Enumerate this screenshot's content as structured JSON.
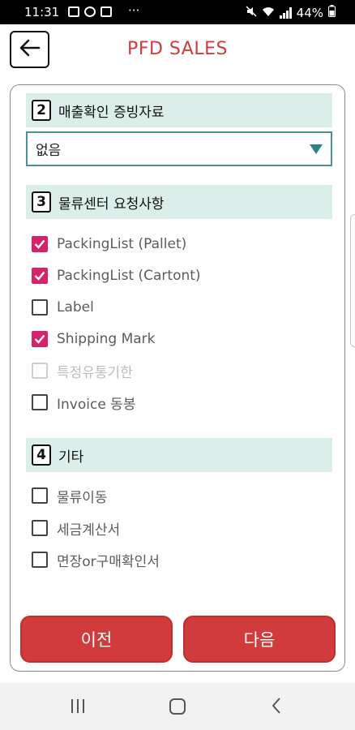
{
  "status_bar": {
    "time": "11:31",
    "dots": "···",
    "battery": "44%"
  },
  "app_bar": {
    "title": "PFD SALES"
  },
  "section2": {
    "number": "2",
    "label": "매출확인 증빙자료",
    "select_value": "없음"
  },
  "section3": {
    "number": "3",
    "label": "물류센터 요청사항",
    "items": [
      {
        "label": "PackingList (Pallet)",
        "checked": true,
        "enabled": true
      },
      {
        "label": "PackingList (Cartont)",
        "checked": true,
        "enabled": true
      },
      {
        "label": "Label",
        "checked": false,
        "enabled": true
      },
      {
        "label": "Shipping Mark",
        "checked": true,
        "enabled": true
      },
      {
        "label": "특정유통기한",
        "checked": false,
        "enabled": false
      },
      {
        "label": "Invoice 동봉",
        "checked": false,
        "enabled": true
      }
    ]
  },
  "section4": {
    "number": "4",
    "label": "기타",
    "items": [
      {
        "label": "물류이동",
        "checked": false,
        "enabled": true
      },
      {
        "label": "세금계산서",
        "checked": false,
        "enabled": true
      },
      {
        "label": "면장or구매확인서",
        "checked": false,
        "enabled": true
      }
    ]
  },
  "buttons": {
    "prev": "이전",
    "next": "다음"
  },
  "colors": {
    "accent_red": "#d13b3b",
    "checkbox_checked": "#d6226a",
    "section_bg": "#dbeee9",
    "select_border": "#4e8e96"
  }
}
